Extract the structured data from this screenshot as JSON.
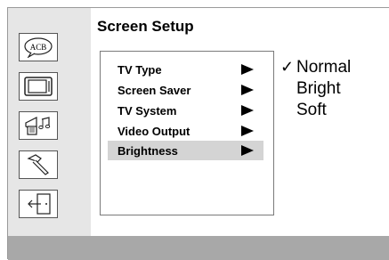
{
  "screen_title": "Screen Setup",
  "sidebar": {
    "icons": [
      {
        "name": "language-icon",
        "glyph_text": "ACB"
      },
      {
        "name": "tv-screen-icon"
      },
      {
        "name": "audio-speaker-icon"
      },
      {
        "name": "hammer-tools-icon"
      },
      {
        "name": "exit-door-icon"
      }
    ]
  },
  "menu": {
    "items": [
      {
        "label": "TV Type"
      },
      {
        "label": "Screen Saver"
      },
      {
        "label": "TV System"
      },
      {
        "label": "Video Output"
      },
      {
        "label": "Brightness",
        "selected": true
      }
    ]
  },
  "options": {
    "checkmark": "✓",
    "items": [
      {
        "label": "Normal",
        "checked": true
      },
      {
        "label": "Bright",
        "checked": false
      },
      {
        "label": "Soft",
        "checked": false
      }
    ]
  },
  "colors": {
    "sidebar_bg": "#e6e6e6",
    "selected_row_bg": "#d4d4d4",
    "bottom_bar_bg": "#a8a8a8"
  }
}
